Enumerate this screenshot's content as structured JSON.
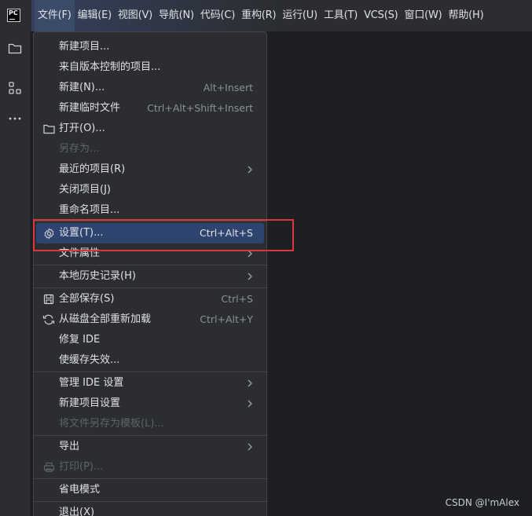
{
  "app": {
    "logo_text": "PC"
  },
  "menubar": {
    "items": [
      {
        "label": "文件(F)"
      },
      {
        "label": "编辑(E)"
      },
      {
        "label": "视图(V)"
      },
      {
        "label": "导航(N)"
      },
      {
        "label": "代码(C)"
      },
      {
        "label": "重构(R)"
      },
      {
        "label": "运行(U)"
      },
      {
        "label": "工具(T)"
      },
      {
        "label": "VCS(S)"
      },
      {
        "label": "窗口(W)"
      },
      {
        "label": "帮助(H)"
      }
    ]
  },
  "toolstrip": {
    "icons": [
      "folder-icon",
      "structure-icon",
      "more-icon"
    ]
  },
  "file_menu": {
    "items": [
      {
        "label": "新建项目..."
      },
      {
        "label": "来自版本控制的项目..."
      },
      {
        "label": "新建(N)...",
        "shortcut": "Alt+Insert"
      },
      {
        "label": "新建临时文件",
        "shortcut": "Ctrl+Alt+Shift+Insert"
      },
      {
        "label": "打开(O)...",
        "icon": "folder-icon"
      },
      {
        "label": "另存为..."
      },
      {
        "label": "最近的项目(R)"
      },
      {
        "label": "关闭项目(J)"
      },
      {
        "label": "重命名项目..."
      },
      {
        "label": "设置(T)...",
        "shortcut": "Ctrl+Alt+S",
        "icon": "gear-icon"
      },
      {
        "label": "文件属性"
      },
      {
        "label": "本地历史记录(H)"
      },
      {
        "label": "全部保存(S)",
        "shortcut": "Ctrl+S",
        "icon": "save-icon"
      },
      {
        "label": "从磁盘全部重新加载",
        "shortcut": "Ctrl+Alt+Y",
        "icon": "reload-icon"
      },
      {
        "label": "修复 IDE"
      },
      {
        "label": "使缓存失效..."
      },
      {
        "label": "管理 IDE 设置"
      },
      {
        "label": "新建项目设置"
      },
      {
        "label": "将文件另存为模板(L)..."
      },
      {
        "label": "导出"
      },
      {
        "label": "打印(P)...",
        "icon": "print-icon"
      },
      {
        "label": "省电模式"
      },
      {
        "label": "退出(X)"
      }
    ]
  },
  "watermark": "CSDN @I'mAlex",
  "colors": {
    "background": "#1e1f22",
    "panel": "#2b2d30",
    "selection": "#2e436e",
    "highlight_border": "#d9363e"
  }
}
